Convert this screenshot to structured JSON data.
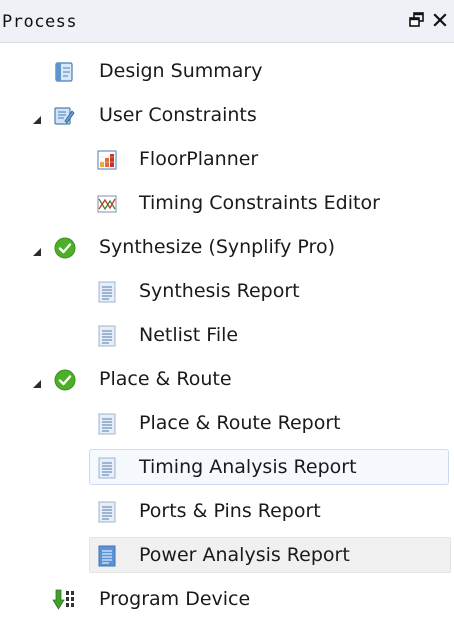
{
  "panel": {
    "title": "Process",
    "float_icon": "float-window-icon",
    "close_icon": "close-icon"
  },
  "tree": {
    "items": [
      {
        "label": "Design Summary",
        "icon": "design-summary-icon",
        "level": 1,
        "expanded": null
      },
      {
        "label": "User Constraints",
        "icon": "user-constraints-icon",
        "level": 0,
        "expanded": true
      },
      {
        "label": "FloorPlanner",
        "icon": "floorplanner-icon",
        "level": 2,
        "expanded": null
      },
      {
        "label": "Timing Constraints Editor",
        "icon": "timing-constraints-icon",
        "level": 2,
        "expanded": null
      },
      {
        "label": "Synthesize (Synplify Pro)",
        "icon": "check-circle-icon",
        "level": 0,
        "expanded": true
      },
      {
        "label": "Synthesis Report",
        "icon": "report-file-icon",
        "level": 2,
        "expanded": null
      },
      {
        "label": "Netlist File",
        "icon": "report-file-icon",
        "level": 2,
        "expanded": null
      },
      {
        "label": "Place & Route",
        "icon": "check-circle-icon",
        "level": 0,
        "expanded": true
      },
      {
        "label": "Place & Route Report",
        "icon": "report-file-icon",
        "level": 2,
        "expanded": null
      },
      {
        "label": "Timing Analysis Report",
        "icon": "report-file-icon",
        "level": 2,
        "expanded": null,
        "state": "hover"
      },
      {
        "label": "Ports & Pins Report",
        "icon": "report-file-icon",
        "level": 2,
        "expanded": null
      },
      {
        "label": "Power Analysis Report",
        "icon": "report-file-icon",
        "level": 2,
        "expanded": null,
        "state": "selected"
      },
      {
        "label": "Program Device",
        "icon": "program-device-icon",
        "level": 1,
        "expanded": null
      }
    ]
  },
  "colors": {
    "header_bg": "#eef1f5",
    "check_green": "#4caf27",
    "hover_border": "#c7dcf0",
    "selected_bg": "#f0f0f0"
  }
}
